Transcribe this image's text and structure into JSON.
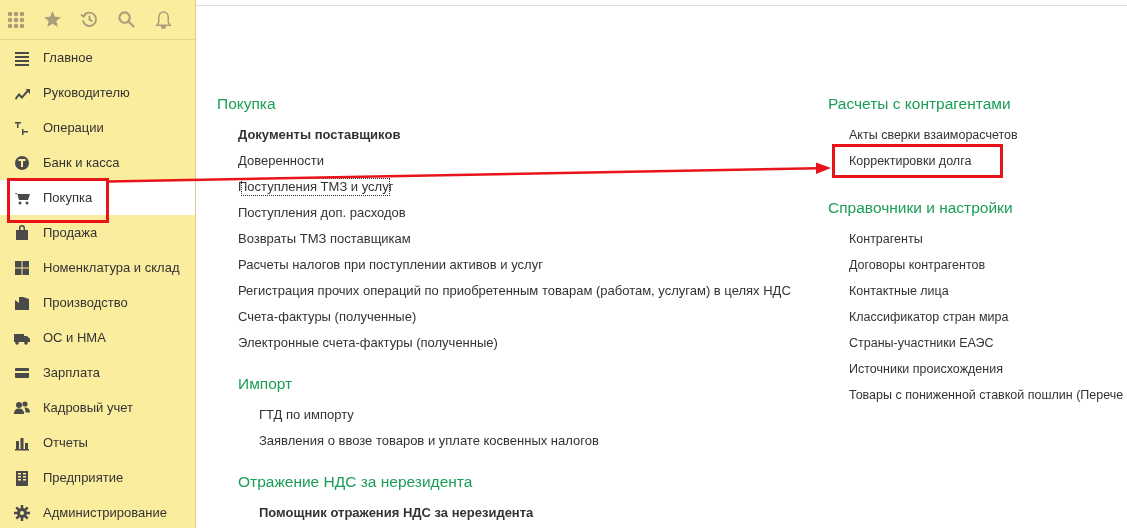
{
  "sidebar": {
    "items": [
      {
        "label": "Главное",
        "selected": false,
        "highlighted": false
      },
      {
        "label": "Руководителю",
        "selected": false,
        "highlighted": false
      },
      {
        "label": "Операции",
        "selected": false,
        "highlighted": false
      },
      {
        "label": "Банк и касса",
        "selected": false,
        "highlighted": false
      },
      {
        "label": "Покупка",
        "selected": true,
        "highlighted": true
      },
      {
        "label": "Продажа",
        "selected": false,
        "highlighted": false
      },
      {
        "label": "Номенклатура и склад",
        "selected": false,
        "highlighted": false
      },
      {
        "label": "Производство",
        "selected": false,
        "highlighted": false
      },
      {
        "label": "ОС и НМА",
        "selected": false,
        "highlighted": false
      },
      {
        "label": "Зарплата",
        "selected": false,
        "highlighted": false
      },
      {
        "label": "Кадровый учет",
        "selected": false,
        "highlighted": false
      },
      {
        "label": "Отчеты",
        "selected": false,
        "highlighted": false
      },
      {
        "label": "Предприятие",
        "selected": false,
        "highlighted": false
      },
      {
        "label": "Администрирование",
        "selected": false,
        "highlighted": false
      }
    ]
  },
  "columns": [
    [
      {
        "title": "Покупка",
        "items": [
          {
            "label": "Документы поставщиков",
            "bold": true,
            "focused": false,
            "highlighted": false
          },
          {
            "label": "Доверенности",
            "bold": false,
            "focused": false,
            "highlighted": false
          },
          {
            "label": "Поступления ТМЗ и услуг",
            "bold": false,
            "focused": true,
            "highlighted": false
          },
          {
            "label": "Поступления доп. расходов",
            "bold": false,
            "focused": false,
            "highlighted": false
          },
          {
            "label": "Возвраты ТМЗ поставщикам",
            "bold": false,
            "focused": false,
            "highlighted": false
          },
          {
            "label": "Расчеты налогов при поступлении активов и услуг",
            "bold": false,
            "focused": false,
            "highlighted": false
          },
          {
            "label": "Регистрация прочих операций по приобретенным товарам (работам, услугам) в целях НДС",
            "bold": false,
            "focused": false,
            "highlighted": false
          },
          {
            "label": "Счета-фактуры (полученные)",
            "bold": false,
            "focused": false,
            "highlighted": false
          },
          {
            "label": "Электронные счета-фактуры (полученные)",
            "bold": false,
            "focused": false,
            "highlighted": false
          }
        ],
        "children": [
          {
            "title": "Импорт",
            "items": [
              {
                "label": "ГТД по импорту",
                "bold": false,
                "focused": false,
                "highlighted": false
              },
              {
                "label": "Заявления о ввозе товаров и уплате косвенных налогов",
                "bold": false,
                "focused": false,
                "highlighted": false
              }
            ]
          },
          {
            "title": "Отражение НДС за нерезидента",
            "items": [
              {
                "label": "Помощник отражения НДС за нерезидента",
                "bold": true,
                "focused": false,
                "highlighted": false
              }
            ]
          }
        ]
      }
    ],
    [
      {
        "title": "Расчеты с контрагентами",
        "items": [
          {
            "label": "Акты сверки взаиморасчетов",
            "bold": false,
            "focused": false,
            "highlighted": false
          },
          {
            "label": "Корректировки долга",
            "bold": false,
            "focused": false,
            "highlighted": true
          }
        ]
      },
      {
        "title": "Справочники и настройки",
        "items": [
          {
            "label": "Контрагенты",
            "bold": false,
            "focused": false,
            "highlighted": false
          },
          {
            "label": "Договоры контрагентов",
            "bold": false,
            "focused": false,
            "highlighted": false
          },
          {
            "label": "Контактные лица",
            "bold": false,
            "focused": false,
            "highlighted": false
          },
          {
            "label": "Классификатор стран мира",
            "bold": false,
            "focused": false,
            "highlighted": false
          },
          {
            "label": "Страны-участники ЕАЭС",
            "bold": false,
            "focused": false,
            "highlighted": false
          },
          {
            "label": "Источники происхождения",
            "bold": false,
            "focused": false,
            "highlighted": false
          },
          {
            "label": "Товары с пониженной ставкой пошлин (Перече",
            "bold": false,
            "focused": false,
            "highlighted": false
          }
        ]
      }
    ]
  ]
}
